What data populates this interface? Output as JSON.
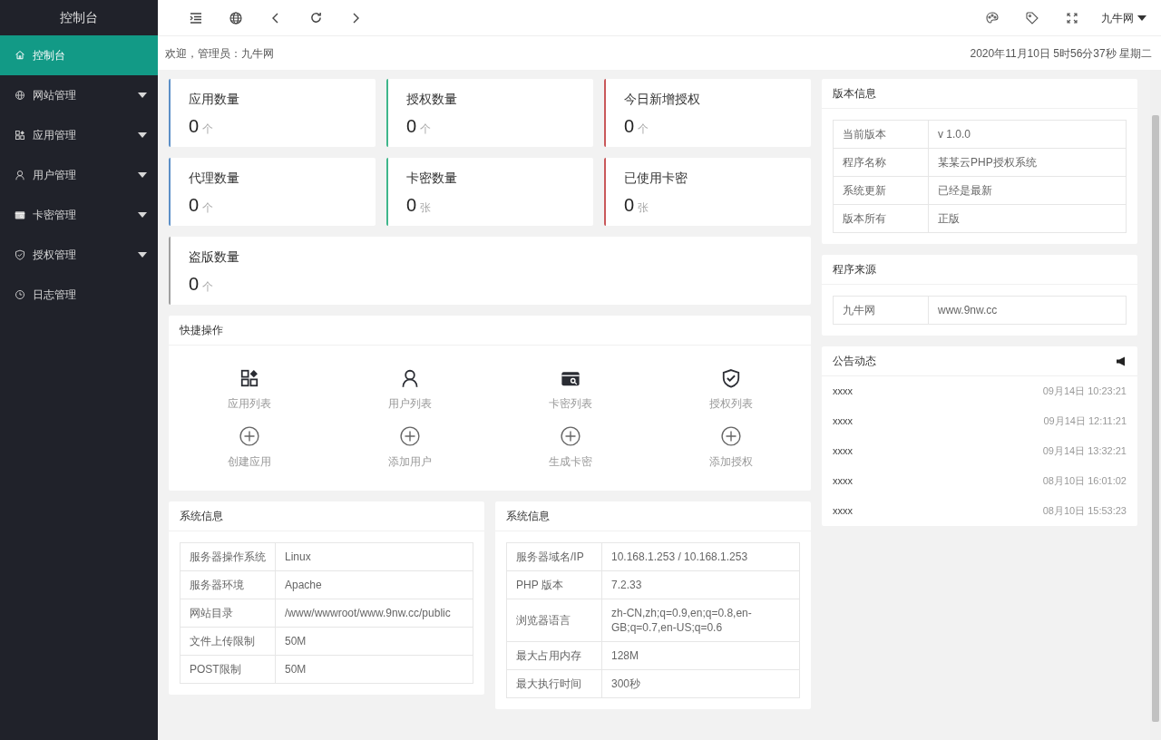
{
  "sidebar": {
    "title": "控制台",
    "items": [
      {
        "label": "控制台",
        "selected": true,
        "has_submenu": false
      },
      {
        "label": "网站管理",
        "selected": false,
        "has_submenu": true
      },
      {
        "label": "应用管理",
        "selected": false,
        "has_submenu": true
      },
      {
        "label": "用户管理",
        "selected": false,
        "has_submenu": true
      },
      {
        "label": "卡密管理",
        "selected": false,
        "has_submenu": true
      },
      {
        "label": "授权管理",
        "selected": false,
        "has_submenu": true
      },
      {
        "label": "日志管理",
        "selected": false,
        "has_submenu": false
      }
    ]
  },
  "topbar": {
    "user": "九牛网"
  },
  "welcome": "欢迎，管理员：九牛网",
  "datetime": "2020年11月10日 5时56分37秒 星期二",
  "stats": [
    {
      "label": "应用数量",
      "value": "0",
      "unit": "个",
      "color": "#5b8fc7"
    },
    {
      "label": "授权数量",
      "value": "0",
      "unit": "个",
      "color": "#3fb68b"
    },
    {
      "label": "今日新增授权",
      "value": "0",
      "unit": "个",
      "color": "#c9585a"
    },
    {
      "label": "代理数量",
      "value": "0",
      "unit": "个",
      "color": "#5b8fc7"
    },
    {
      "label": "卡密数量",
      "value": "0",
      "unit": "张",
      "color": "#3fb68b"
    },
    {
      "label": "已使用卡密",
      "value": "0",
      "unit": "张",
      "color": "#c9585a"
    },
    {
      "label": "盗版数量",
      "value": "0",
      "unit": "个",
      "color": "#a0a0a0"
    }
  ],
  "quick_actions": {
    "title": "快捷操作",
    "items": [
      {
        "label": "应用列表",
        "kind": "list"
      },
      {
        "label": "用户列表",
        "kind": "list"
      },
      {
        "label": "卡密列表",
        "kind": "list"
      },
      {
        "label": "授权列表",
        "kind": "list"
      },
      {
        "label": "创建应用",
        "kind": "add"
      },
      {
        "label": "添加用户",
        "kind": "add"
      },
      {
        "label": "生成卡密",
        "kind": "add"
      },
      {
        "label": "添加授权",
        "kind": "add"
      }
    ]
  },
  "system_info_left": {
    "title": "系统信息",
    "rows": [
      {
        "label": "服务器操作系统",
        "value": "Linux"
      },
      {
        "label": "服务器环境",
        "value": "Apache"
      },
      {
        "label": "网站目录",
        "value": "/www/wwwroot/www.9nw.cc/public"
      },
      {
        "label": "文件上传限制",
        "value": "50M"
      },
      {
        "label": "POST限制",
        "value": "50M"
      }
    ]
  },
  "system_info_right": {
    "title": "系统信息",
    "rows": [
      {
        "label": "服务器域名/IP",
        "value": "10.168.1.253 / 10.168.1.253"
      },
      {
        "label": "PHP 版本",
        "value": "7.2.33"
      },
      {
        "label": "浏览器语言",
        "value": "zh-CN,zh;q=0.9,en;q=0.8,en-GB;q=0.7,en-US;q=0.6"
      },
      {
        "label": "最大占用内存",
        "value": "128M"
      },
      {
        "label": "最大执行时间",
        "value": "300秒"
      }
    ]
  },
  "version_info": {
    "title": "版本信息",
    "rows": [
      {
        "label": "当前版本",
        "value": "v 1.0.0"
      },
      {
        "label": "程序名称",
        "value": "某某云PHP授权系统"
      },
      {
        "label": "系统更新",
        "value": "已经是最新"
      },
      {
        "label": "版本所有",
        "value": "正版"
      }
    ]
  },
  "program_source": {
    "title": "程序来源",
    "rows": [
      {
        "label": "九牛网",
        "value": "www.9nw.cc"
      }
    ]
  },
  "announcements": {
    "title": "公告动态",
    "items": [
      {
        "text": "xxxx",
        "time": "09月14日 10:23:21"
      },
      {
        "text": "xxxx",
        "time": "09月14日 12:11:21"
      },
      {
        "text": "xxxx",
        "time": "09月14日 13:32:21"
      },
      {
        "text": "xxxx",
        "time": "08月10日 16:01:02"
      },
      {
        "text": "xxxx",
        "time": "08月10日 15:53:23"
      }
    ]
  }
}
